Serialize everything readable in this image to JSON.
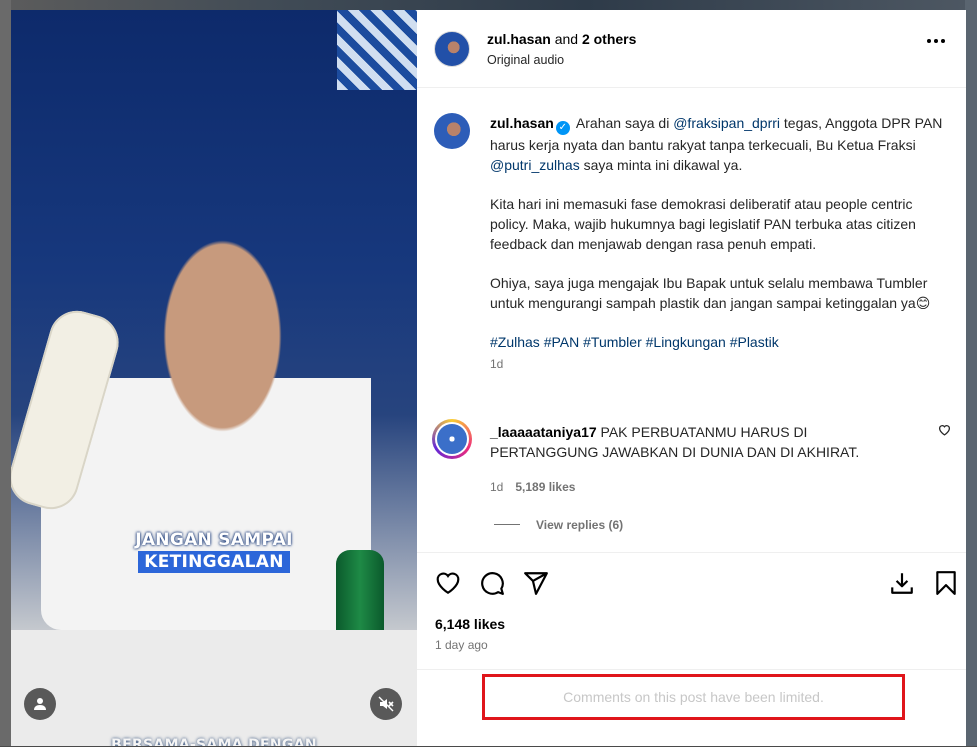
{
  "media": {
    "caption_line1": "JANGAN SAMPAI",
    "caption_line2": "KETINGGALAN",
    "caption_line3": "BERSAMA-SAMA DENGAN"
  },
  "header": {
    "username": "zul.hasan",
    "and_text": "and",
    "others": "2 others",
    "audio": "Original audio"
  },
  "caption": {
    "username": "zul.hasan",
    "p1_a": "Arahan saya di",
    "mention1": "@fraksipan_dprri",
    "p1_b": "tegas, Anggota DPR PAN harus kerja nyata dan bantu rakyat tanpa terkecuali, Bu Ketua Fraksi",
    "mention2": "@putri_zulhas",
    "p1_c": "saya minta ini dikawal ya.",
    "p2": "Kita hari ini memasuki fase demokrasi deliberatif atau people centric policy. Maka, wajib hukumnya bagi legislatif PAN terbuka atas citizen feedback dan menjawab dengan rasa penuh empati.",
    "p3": "Ohiya, saya juga mengajak Ibu Bapak untuk selalu membawa Tumbler untuk mengurangi sampah plastik dan jangan sampai ketinggalan ya😊",
    "hashtags": "#Zulhas #PAN #Tumbler #Lingkungan #Plastik",
    "time": "1d"
  },
  "comment": {
    "username": "_laaaaataniya17",
    "text": "PAK PERBUATANMU HARUS DI PERTANGGUNG JAWABKAN DI DUNIA DAN DI AKHIRAT.",
    "time": "1d",
    "likes": "5,189 likes",
    "view_replies": "View replies (6)"
  },
  "post": {
    "likes": "6,148 likes",
    "ago": "1 day ago",
    "limited_notice": "Comments on this post have been limited."
  },
  "colors": {
    "link": "#00376b",
    "verified": "#0095f6",
    "highlight_box": "#e0151b"
  }
}
